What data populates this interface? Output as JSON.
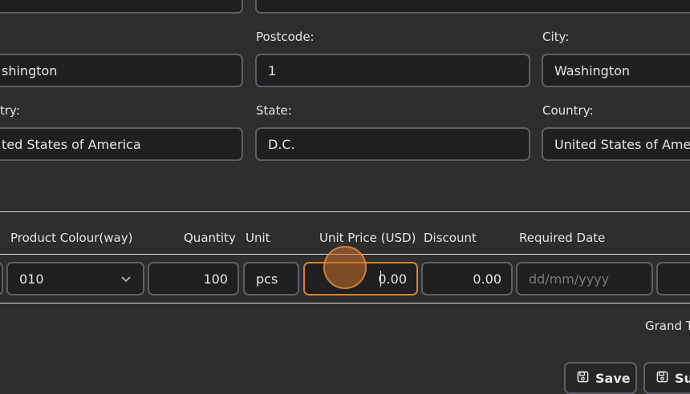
{
  "address": {
    "row1": {
      "city_label": "Postcode:",
      "left_value": "shington",
      "postcode_label": "Postcode:",
      "postcode_value": "1",
      "city_right_label": "City:",
      "city_right_value": "Washington"
    },
    "row2": {
      "left_label": "try:",
      "left_value": "ted States of America",
      "state_label": "State:",
      "state_value": "D.C.",
      "country_label": "Country:",
      "country_value": "United States of America"
    }
  },
  "table": {
    "headers": {
      "colour": "Product Colour(way)",
      "quantity": "Quantity",
      "unit": "Unit",
      "unit_price": "Unit Price (USD)",
      "discount": "Discount",
      "required_date": "Required Date"
    },
    "row": {
      "colour": "010",
      "quantity": "100",
      "unit": "pcs",
      "unit_price": "0.00",
      "discount": "0.00",
      "required_date_placeholder": "dd/mm/yyyy"
    }
  },
  "grand_total_label": "Grand T",
  "buttons": {
    "save": "Save",
    "submit": "Su"
  },
  "colors": {
    "background": "#2d2d2d",
    "field_bg": "#1f1f1f",
    "border": "#5c5f66",
    "focus": "#d9822b"
  }
}
